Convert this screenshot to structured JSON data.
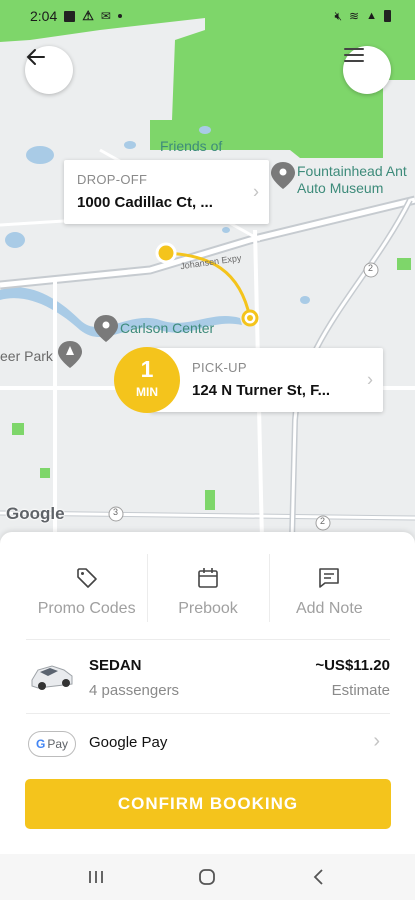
{
  "status_bar": {
    "time": "2:04",
    "left_icons": [
      "gallery-icon",
      "alert-icon",
      "messenger-icon"
    ],
    "right_icons": [
      "mute-icon",
      "wifi-icon",
      "signal-icon",
      "battery-icon"
    ]
  },
  "map": {
    "labels": {
      "friends_of": "Friends of",
      "museum_line1": "Fountainhead Ant",
      "museum_line2": "Auto Museum",
      "carlson": "Carlson Center",
      "deer_park": "eer Park",
      "expressway": "Johansen Expy",
      "route_3": "3",
      "route_2": "2"
    },
    "attribution": "Google"
  },
  "dropoff": {
    "caption": "DROP-OFF",
    "address": "1000 Cadillac Ct, ..."
  },
  "pickup": {
    "caption": "PICK-UP",
    "address": "124 N Turner St, F..."
  },
  "eta": {
    "value": "1",
    "unit": "MIN"
  },
  "options": [
    {
      "label": "Promo Codes",
      "icon": "tag-icon"
    },
    {
      "label": "Prebook",
      "icon": "calendar-icon"
    },
    {
      "label": "Add Note",
      "icon": "note-icon"
    }
  ],
  "vehicle": {
    "type": "SEDAN",
    "passengers": "4 passengers",
    "price": "~US$11.20",
    "price_note": "Estimate"
  },
  "payment": {
    "badge": "Pay",
    "method": "Google Pay"
  },
  "confirm_button": "CONFIRM BOOKING",
  "colors": {
    "accent": "#f4c41c",
    "park_green": "#7ed66a",
    "map_bg": "#eceeef",
    "water": "#a9cbe6"
  }
}
